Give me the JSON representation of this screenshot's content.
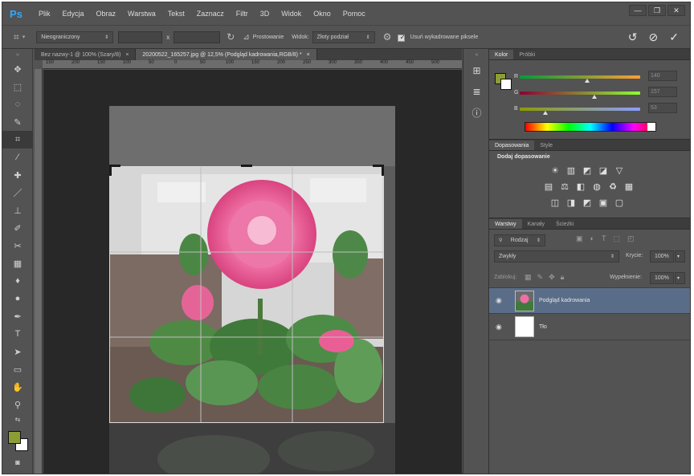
{
  "app": {
    "logo": "Ps"
  },
  "menu": [
    "Plik",
    "Edycja",
    "Obraz",
    "Warstwa",
    "Tekst",
    "Zaznacz",
    "Filtr",
    "3D",
    "Widok",
    "Okno",
    "Pomoc"
  ],
  "window_controls": [
    "—",
    "❐",
    "✕"
  ],
  "options": {
    "ratio_select": "Nieograniczony",
    "ratio_separator": "x",
    "straighten_label": "Prostowanie",
    "view_label": "Widok:",
    "view_select": "Złoty podział",
    "delete_pixels_label": "Usuń wykadrowane piksele",
    "delete_pixels_checked": true
  },
  "tabs": [
    {
      "label": "Bez nazwy-1 @ 100% (Szary/8)",
      "active": false
    },
    {
      "label": "20200522_165257.jpg @ 12,5% (Podgląd kadrowania,RGB/8) *",
      "active": true
    }
  ],
  "ruler_ticks": [
    "150",
    "200",
    "150",
    "100",
    "50",
    "0",
    "50",
    "100",
    "150",
    "200",
    "250",
    "300",
    "350",
    "400",
    "450",
    "500"
  ],
  "color_panel": {
    "tabs": [
      "Kolor",
      "Próbki"
    ],
    "channels": [
      {
        "label": "R",
        "value": "140",
        "pos": 0.56
      },
      {
        "label": "G",
        "value": "157",
        "pos": 0.62
      },
      {
        "label": "B",
        "value": "53",
        "pos": 0.21
      }
    ],
    "fg_color": "#8c9d35",
    "bg_color": "#ffffff"
  },
  "adjustments_panel": {
    "tabs": [
      "Dopasowania",
      "Style"
    ],
    "heading": "Dodaj dopasowanie"
  },
  "layers_panel": {
    "tabs": [
      "Warstwy",
      "Kanały",
      "Ścieżki"
    ],
    "filter_select": "Rodzaj",
    "blend_select": "Zwykły",
    "opacity_label": "Krycie:",
    "opacity_value": "100%",
    "lock_label": "Zablokuj:",
    "fill_label": "Wypełnienie:",
    "fill_value": "100%",
    "layers": [
      {
        "name": "Podgląd kadrowania",
        "selected": true
      },
      {
        "name": "Tło",
        "selected": false
      }
    ]
  }
}
